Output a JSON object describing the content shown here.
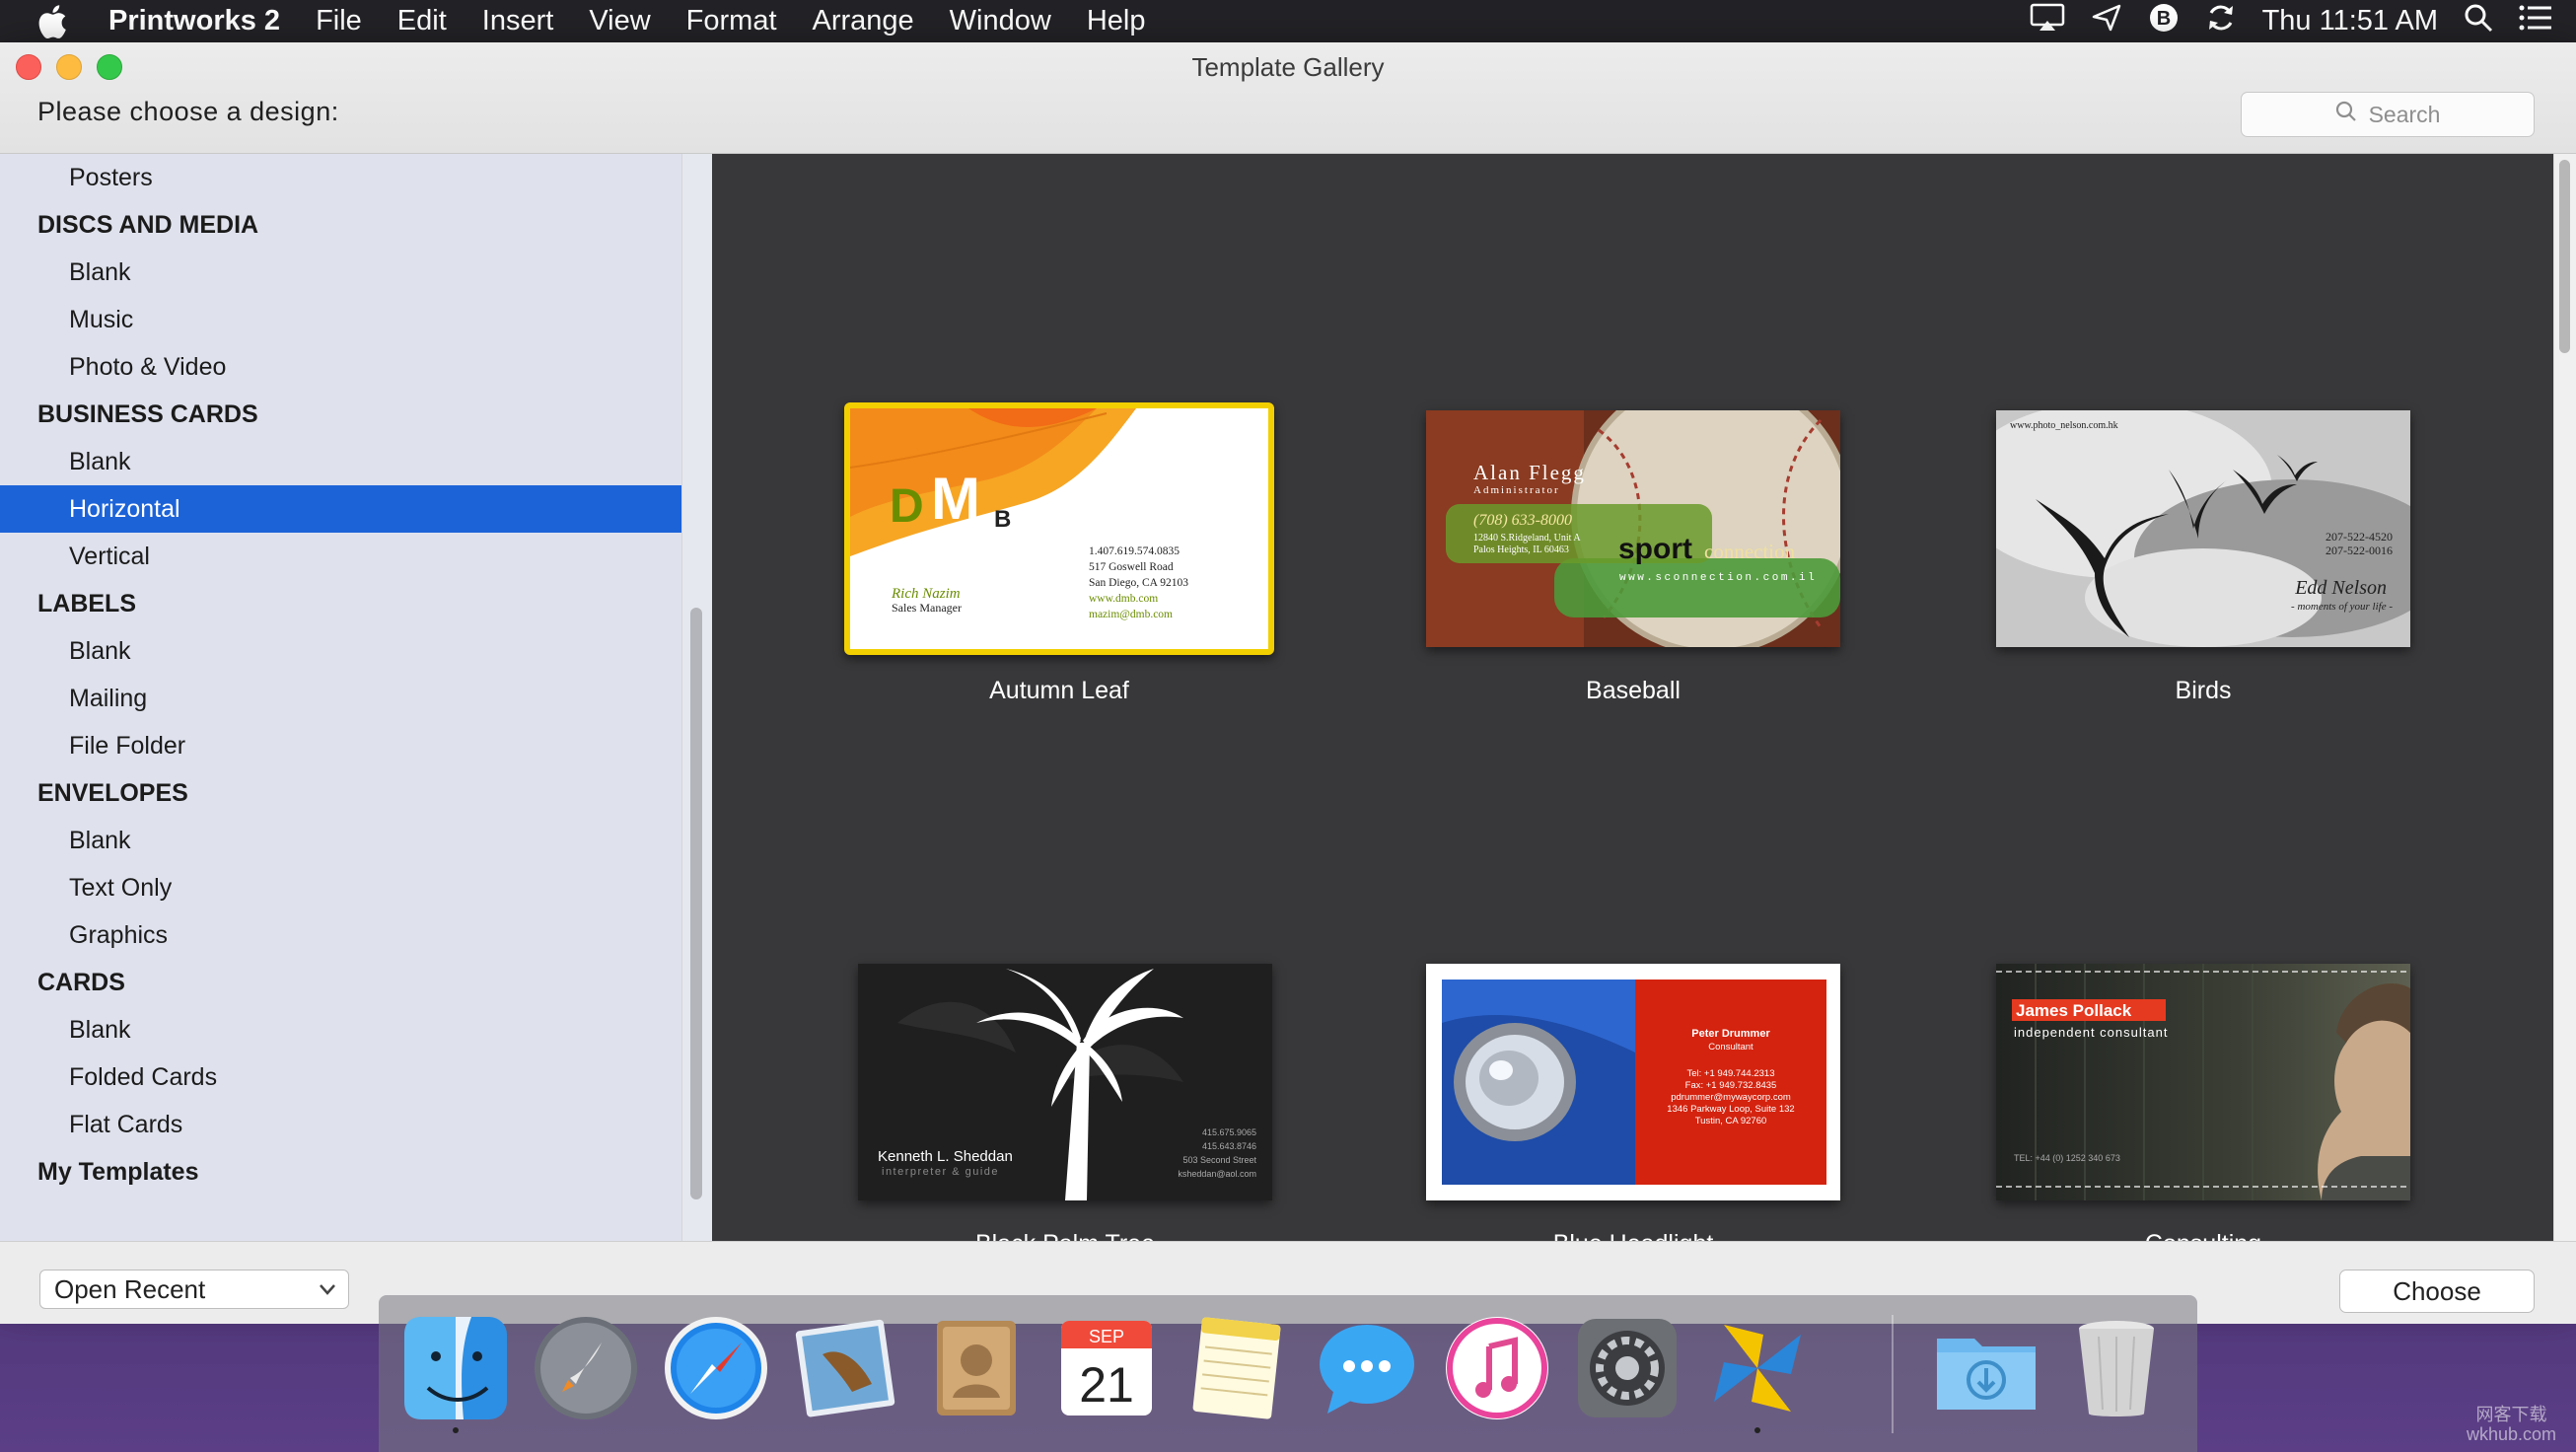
{
  "menubar": {
    "app_name": "Printworks 2",
    "items": [
      "File",
      "Edit",
      "Insert",
      "View",
      "Format",
      "Arrange",
      "Window",
      "Help"
    ],
    "clock": "Thu 11:51 AM"
  },
  "window": {
    "title": "Template Gallery",
    "prompt": "Please choose a design:",
    "search_placeholder": "Search"
  },
  "sidebar": {
    "rows": [
      {
        "label": "Posters",
        "kind": "item"
      },
      {
        "label": "DISCS AND MEDIA",
        "kind": "header"
      },
      {
        "label": "Blank",
        "kind": "item"
      },
      {
        "label": "Music",
        "kind": "item"
      },
      {
        "label": "Photo & Video",
        "kind": "item"
      },
      {
        "label": "BUSINESS CARDS",
        "kind": "header"
      },
      {
        "label": "Blank",
        "kind": "item"
      },
      {
        "label": "Horizontal",
        "kind": "item",
        "selected": true
      },
      {
        "label": "Vertical",
        "kind": "item"
      },
      {
        "label": "LABELS",
        "kind": "header"
      },
      {
        "label": "Blank",
        "kind": "item"
      },
      {
        "label": "Mailing",
        "kind": "item"
      },
      {
        "label": "File Folder",
        "kind": "item"
      },
      {
        "label": "ENVELOPES",
        "kind": "header"
      },
      {
        "label": "Blank",
        "kind": "item"
      },
      {
        "label": "Text Only",
        "kind": "item"
      },
      {
        "label": "Graphics",
        "kind": "item"
      },
      {
        "label": "CARDS",
        "kind": "header"
      },
      {
        "label": "Blank",
        "kind": "item"
      },
      {
        "label": "Folded Cards",
        "kind": "item"
      },
      {
        "label": "Flat Cards",
        "kind": "item"
      },
      {
        "label": "My Templates",
        "kind": "header"
      }
    ]
  },
  "templates": [
    {
      "label": "Autumn Leaf",
      "selected": true,
      "card": {
        "logo": "DMB",
        "name": "Rich Nazim",
        "role": "Sales Manager",
        "lines": [
          "1.407.619.574.0835",
          "517 Goswell Road",
          "San Diego, CA 92103",
          "www.dmb.com",
          "mazim@dmb.com"
        ]
      }
    },
    {
      "label": "Baseball",
      "card": {
        "name": "Alan Flegg",
        "role": "Administrator",
        "phone": "(708) 633-8000",
        "address": "12840 S.Ridgeland, Unit A",
        "city": "Palos Heights, IL 60463",
        "brand_bold": "sport",
        "brand_rest": "connection",
        "web": "www.sconnection.com.il"
      }
    },
    {
      "label": "Birds",
      "card": {
        "web": "www.photo_nelson.com.hk",
        "phone1": "207-522-4520",
        "phone2": "207-522-0016",
        "name": "Edd Nelson",
        "tagline": "- moments of your life -"
      }
    },
    {
      "label": "Black Palm Tree",
      "card": {
        "name": "Kenneth L. Sheddan",
        "role": "interpreter & guide",
        "lines": [
          "415.675.9065",
          "415.643.8746",
          "503 Second Street",
          "ksheddan@aol.com"
        ]
      }
    },
    {
      "label": "Blue Headlight",
      "card": {
        "name": "Peter Drummer",
        "role": "Consultant",
        "lines": [
          "Tel: +1 949.744.2313",
          "Fax: +1 949.732.8435",
          "pdrummer@mywaycorp.com",
          "1346 Parkway Loop, Suite 132",
          "Tustin, CA 92760"
        ]
      }
    },
    {
      "label": "Consulting",
      "card": {
        "name": "James Pollack",
        "role": "independent consultant",
        "tel": "TEL: +44 (0) 1252 340 673"
      }
    }
  ],
  "bottombar": {
    "open_recent": "Open Recent",
    "choose": "Choose"
  },
  "dock": {
    "calendar_month": "SEP",
    "calendar_day": "21",
    "icons": [
      "finder-icon",
      "launchpad-icon",
      "safari-icon",
      "mail-icon",
      "contacts-icon",
      "calendar-icon",
      "notes-icon",
      "messages-icon",
      "itunes-icon",
      "system-preferences-icon",
      "printworks-icon",
      "downloads-folder-icon",
      "trash-icon"
    ]
  },
  "watermark": {
    "line1": "网客下载",
    "line2": "wkhub.com"
  }
}
